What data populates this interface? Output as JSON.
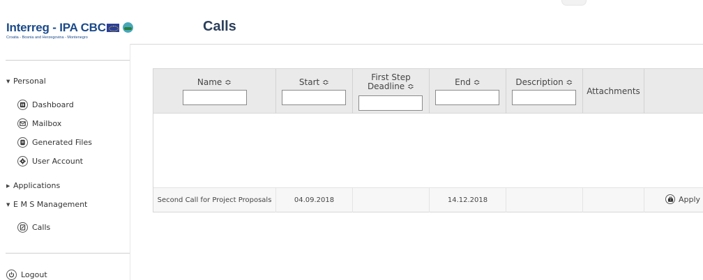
{
  "logo": {
    "title": "Interreg - IPA CBC",
    "subtitle": "Croatia - Bosnia and Herzegovina - Montenegro"
  },
  "page": {
    "title": "Calls"
  },
  "sidebar": {
    "personal": {
      "label": "Personal",
      "items": [
        {
          "label": "Dashboard",
          "icon": "dashboard-icon"
        },
        {
          "label": "Mailbox",
          "icon": "mail-icon"
        },
        {
          "label": "Generated Files",
          "icon": "file-icon"
        },
        {
          "label": "User Account",
          "icon": "gear-icon"
        }
      ]
    },
    "applications": {
      "label": "Applications"
    },
    "ems": {
      "label": "E M S Management",
      "items": [
        {
          "label": "Calls",
          "icon": "calls-icon"
        }
      ]
    },
    "logout": "Logout"
  },
  "table": {
    "columns": [
      {
        "label": "Name ≎"
      },
      {
        "label": "Start ≎"
      },
      {
        "label_line1": "First Step",
        "label_line2": "Deadline ≎"
      },
      {
        "label": "End ≎"
      },
      {
        "label": "Description ≎"
      },
      {
        "label": "Attachments"
      }
    ],
    "rows": [
      {
        "name": "Second Call for Project Proposals",
        "start": "04.09.2018",
        "first_step_deadline": "",
        "end": "14.12.2018",
        "description": "",
        "attachments": "",
        "action": "Apply"
      }
    ]
  },
  "colors": {
    "title": "#2b3f5c",
    "logo": "#1a4a8a",
    "header_bg": "#eaeaea"
  }
}
